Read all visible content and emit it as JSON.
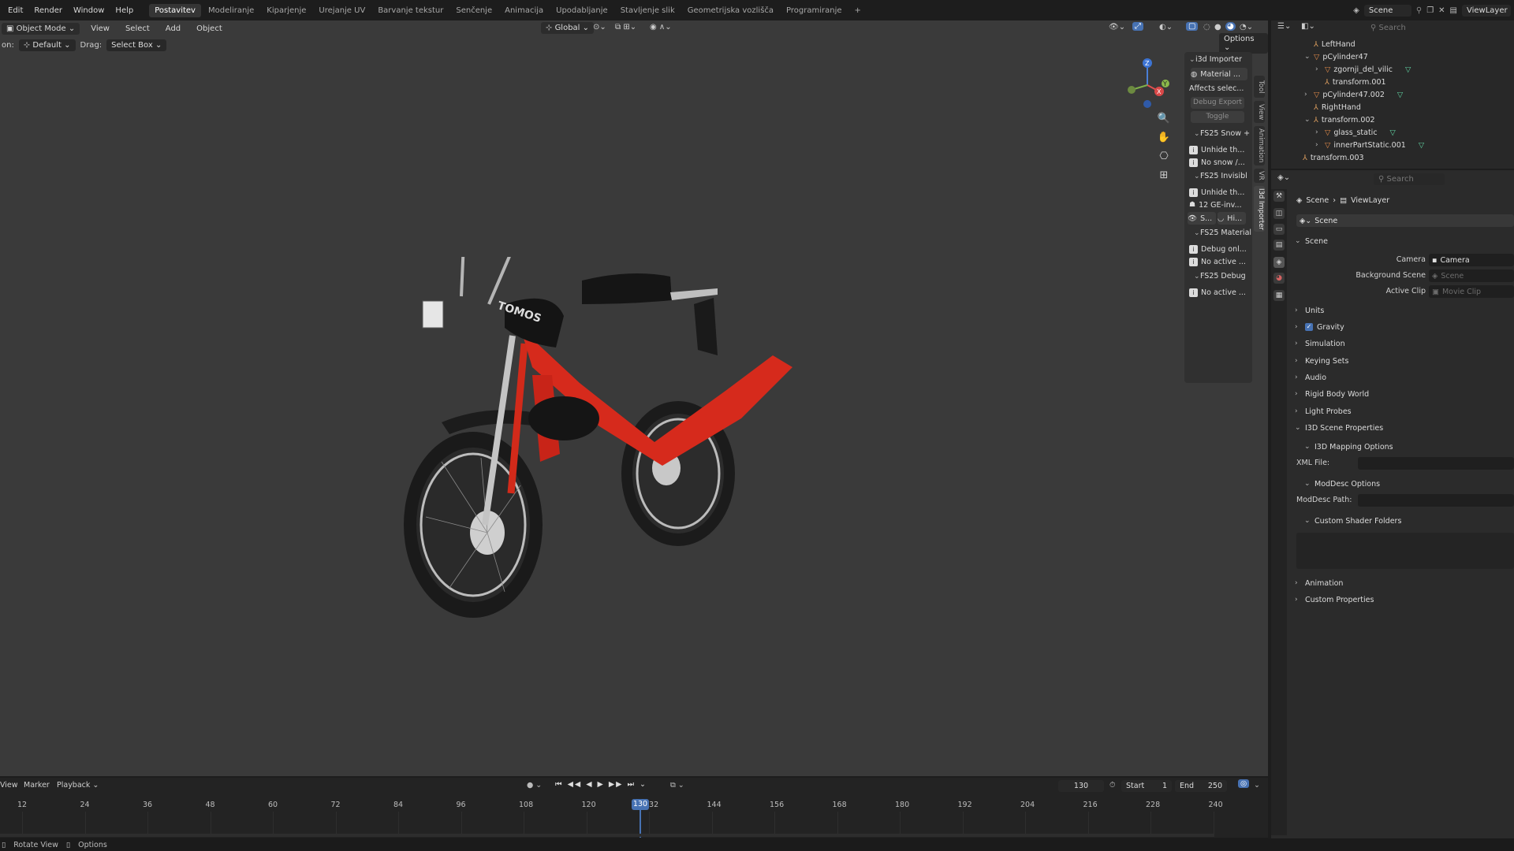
{
  "topbar": {
    "menus": [
      "Edit",
      "Render",
      "Window",
      "Help"
    ],
    "workspaces": [
      "Postavitev",
      "Modeliranje",
      "Kiparjenje",
      "Urejanje UV",
      "Barvanje tekstur",
      "Senčenje",
      "Animacija",
      "Upodabljanje",
      "Stavljenje slik",
      "Geometrijska vozlišča",
      "Programiranje"
    ],
    "active_workspace": "Postavitev",
    "add_tab": "+",
    "scene_name": "Scene",
    "view_layer": "ViewLayer"
  },
  "viewport": {
    "mode": "Object Mode",
    "menus": [
      "View",
      "Select",
      "Add",
      "Object"
    ],
    "transform_orientation": "Global",
    "options_label": "Options",
    "orientation_label": "on:",
    "orientation_value": "Default",
    "drag_label": "Drag:",
    "drag_value": "Select Box",
    "model_brand": "TOMOS"
  },
  "npanel": {
    "title": "i3d Importer",
    "material_btn": "Material ...",
    "affects_text": "Affects selec...",
    "debug_export_btn": "Debug Export",
    "toggle_btn": "Toggle",
    "snow_title": "FS25 Snow +",
    "snow_rows": [
      "Unhide th...",
      "No snow /..."
    ],
    "invis_title": "FS25 Invisibl",
    "invis_rows": [
      "Unhide th...",
      "12 GE-inv..."
    ],
    "eye_btn": "S...",
    "hi_btn": "Hi...",
    "material_title": "FS25 Material",
    "material_rows": [
      "Debug onl...",
      "No active ..."
    ],
    "debug_title": "FS25 Debug",
    "debug_rows": [
      "No active ..."
    ],
    "vtabs": [
      "Tool",
      "View",
      "Animation",
      "VR",
      "I3d Importer"
    ]
  },
  "timeline": {
    "menus": [
      "View",
      "Marker",
      "Playback"
    ],
    "current_frame": "130",
    "start_label": "Start",
    "start_value": "1",
    "end_label": "End",
    "end_value": "250",
    "ticks": [
      "12",
      "24",
      "36",
      "48",
      "60",
      "72",
      "84",
      "96",
      "108",
      "120",
      "132",
      "144",
      "156",
      "168",
      "180",
      "192",
      "204",
      "216",
      "228",
      "240"
    ],
    "playhead_label": "130"
  },
  "statusbar": {
    "items": [
      "Rotate View",
      "Options"
    ]
  },
  "outliner": {
    "search_placeholder": "Search",
    "rows": [
      {
        "label": "LeftHand",
        "indent": 2,
        "type": "empty"
      },
      {
        "label": "pCylinder47",
        "indent": 2,
        "type": "mesh-expanded"
      },
      {
        "label": "zgornji_del_vilic",
        "indent": 3,
        "type": "mesh"
      },
      {
        "label": "transform.001",
        "indent": 3,
        "type": "empty"
      },
      {
        "label": "pCylinder47.002",
        "indent": 2,
        "type": "mesh"
      },
      {
        "label": "RightHand",
        "indent": 2,
        "type": "empty"
      },
      {
        "label": "transform.002",
        "indent": 2,
        "type": "empty-expanded"
      },
      {
        "label": "glass_static",
        "indent": 3,
        "type": "mesh"
      },
      {
        "label": "innerPartStatic.001",
        "indent": 3,
        "type": "mesh"
      },
      {
        "label": "transform.003",
        "indent": 1,
        "type": "empty"
      }
    ]
  },
  "properties": {
    "search_placeholder": "Search",
    "breadcrumb": [
      "Scene",
      "ViewLayer"
    ],
    "datablock": "Scene",
    "scene_section": "Scene",
    "camera_label": "Camera",
    "camera_value": "Camera",
    "bg_scene_label": "Background Scene",
    "bg_scene_value": "Scene",
    "active_clip_label": "Active Clip",
    "active_clip_value": "Movie Clip",
    "sections": [
      "Units",
      "Gravity",
      "Simulation",
      "Keying Sets",
      "Audio",
      "Rigid Body World",
      "Light Probes",
      "I3D Scene Properties"
    ],
    "i3d_mapping": "I3D Mapping Options",
    "xml_label": "XML File:",
    "moddesc_options": "ModDesc Options",
    "moddesc_label": "ModDesc Path:",
    "custom_shader": "Custom Shader Folders",
    "bottom_sections": [
      "Animation",
      "Custom Properties"
    ]
  },
  "colors": {
    "accent": "#4772b3",
    "frame_red": "#d62a1c",
    "viewport_bg": "#3a3a3a"
  }
}
